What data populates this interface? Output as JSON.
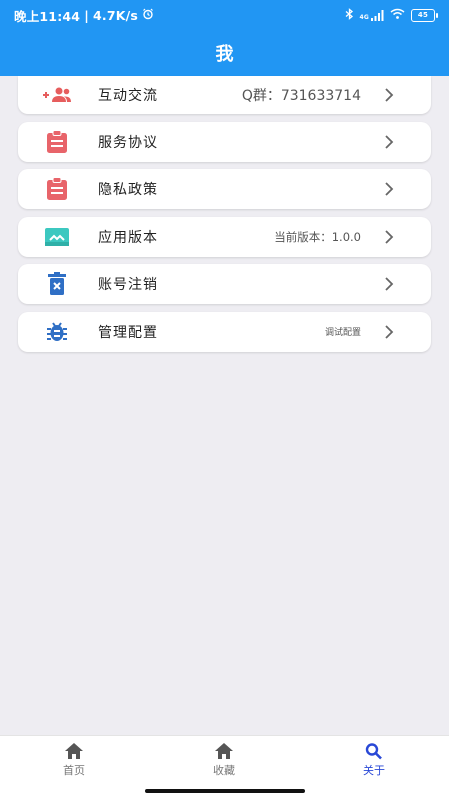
{
  "status_bar": {
    "time": "晚上11:44",
    "network_speed": "4.7K/s",
    "signal_text": "4G",
    "battery": "45"
  },
  "header": {
    "title": "我"
  },
  "menu": [
    {
      "label": "互动交流",
      "value": "Q群：731633714",
      "icon": "add-group-icon",
      "icon_color": "#e65d5d"
    },
    {
      "label": "服务协议",
      "value": "",
      "icon": "clipboard-icon",
      "icon_color": "#e8646a"
    },
    {
      "label": "隐私政策",
      "value": "",
      "icon": "clipboard-icon",
      "icon_color": "#e8646a"
    },
    {
      "label": "应用版本",
      "value": "当前版本：1.0.0",
      "icon": "version-icon",
      "icon_color": "#3cc8c0"
    },
    {
      "label": "账号注销",
      "value": "",
      "icon": "trash-icon",
      "icon_color": "#2f6fc5"
    },
    {
      "label": "管理配置",
      "value": "调试配置",
      "icon": "bug-icon",
      "icon_color": "#2f6fc5"
    }
  ],
  "tabs": [
    {
      "label": "首页",
      "icon": "home-icon",
      "active": false
    },
    {
      "label": "收藏",
      "icon": "home-icon",
      "active": false
    },
    {
      "label": "关于",
      "icon": "search-icon",
      "active": true
    }
  ],
  "colors": {
    "primary": "#2196f3",
    "active_tab": "#2948d6",
    "background": "#eeedf2"
  }
}
